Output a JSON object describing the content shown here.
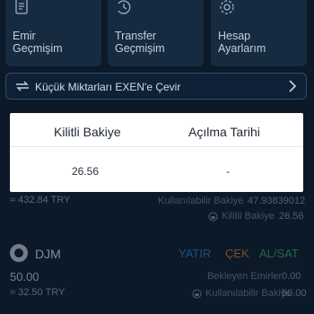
{
  "tiles": [
    {
      "label": "Emir\nGeçmişim",
      "icon": "document-icon"
    },
    {
      "label": "Transfer\nGeçmişim",
      "icon": "history-icon"
    },
    {
      "label": "Hesap\nAyarlarım",
      "icon": "gear-icon"
    }
  ],
  "banner": {
    "label": "Küçük Miktarları EXEN'e Çevir",
    "icon": "convert-icon",
    "chevron": "chevron-right-icon"
  },
  "asset1": {
    "try_value": "≈ 432.84 TRY",
    "available_label": "Kullanılabilir Bakiye",
    "available_value": "47.93839012",
    "locked_label": "Kilitli Bakiye",
    "locked_value": "26.56"
  },
  "modal": {
    "col1_header": "Kilitli Bakiye",
    "col2_header": "Açılma Tarihi",
    "col1_value": "26.56",
    "col2_value": "-"
  },
  "asset2": {
    "symbol": "DJM",
    "deposit": "YATIR",
    "withdraw": "ÇEK",
    "trade": "AL/SAT",
    "amount": "50.00",
    "try_value": "≈ 32.50 TRY",
    "pending_label": "Bekleyen Emirler",
    "pending_value": "0.00",
    "available_label": "Kullanılabilir Bakiye",
    "available_value": "50.00"
  },
  "colors": {
    "deposit": "#2f7fd0",
    "withdraw": "#e07a1f",
    "trade": "#3aa35a"
  }
}
